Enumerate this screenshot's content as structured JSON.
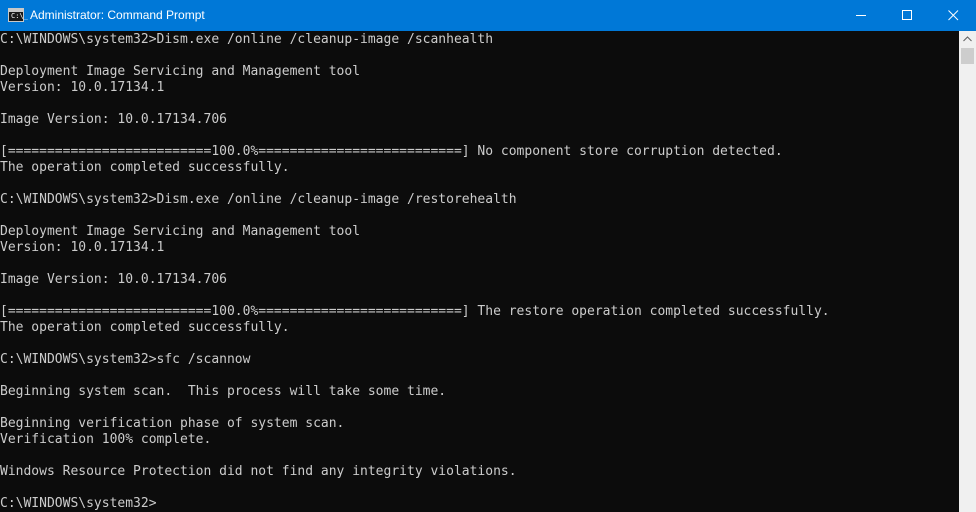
{
  "window": {
    "title": "Administrator: Command Prompt",
    "app_icon_text": "C:\\_",
    "titlebar_color": "#0078d7",
    "console_bg": "#0c0c0c",
    "console_fg": "#cccccc"
  },
  "controls": {
    "minimize_icon": "minimize-icon",
    "maximize_icon": "maximize-icon",
    "close_icon": "close-icon"
  },
  "console": {
    "lines": [
      "C:\\WINDOWS\\system32>Dism.exe /online /cleanup-image /scanhealth",
      "",
      "Deployment Image Servicing and Management tool",
      "Version: 10.0.17134.1",
      "",
      "Image Version: 10.0.17134.706",
      "",
      "[==========================100.0%==========================] No component store corruption detected.",
      "The operation completed successfully.",
      "",
      "C:\\WINDOWS\\system32>Dism.exe /online /cleanup-image /restorehealth",
      "",
      "Deployment Image Servicing and Management tool",
      "Version: 10.0.17134.1",
      "",
      "Image Version: 10.0.17134.706",
      "",
      "[==========================100.0%==========================] The restore operation completed successfully.",
      "The operation completed successfully.",
      "",
      "C:\\WINDOWS\\system32>sfc /scannow",
      "",
      "Beginning system scan.  This process will take some time.",
      "",
      "Beginning verification phase of system scan.",
      "Verification 100% complete.",
      "",
      "Windows Resource Protection did not find any integrity violations.",
      "",
      "C:\\WINDOWS\\system32>"
    ]
  }
}
